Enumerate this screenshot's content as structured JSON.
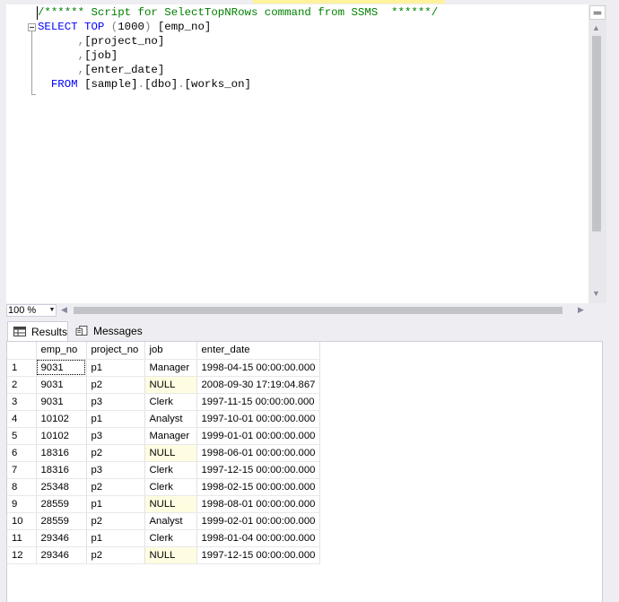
{
  "editor": {
    "lines": [
      [
        {
          "t": "/****** Script for SelectTopNRows command from SSMS  ******/",
          "c": "cm"
        }
      ],
      [
        {
          "t": "SELECT TOP ",
          "c": "kw"
        },
        {
          "t": "(",
          "c": "gr"
        },
        {
          "t": "1000",
          "c": "tx"
        },
        {
          "t": ")",
          "c": "gr"
        },
        {
          "t": " [emp_no]",
          "c": "tx"
        }
      ],
      [
        {
          "t": "      ",
          "c": "tx"
        },
        {
          "t": ",",
          "c": "gr"
        },
        {
          "t": "[project_no]",
          "c": "tx"
        }
      ],
      [
        {
          "t": "      ",
          "c": "tx"
        },
        {
          "t": ",",
          "c": "gr"
        },
        {
          "t": "[job]",
          "c": "tx"
        }
      ],
      [
        {
          "t": "      ",
          "c": "tx"
        },
        {
          "t": ",",
          "c": "gr"
        },
        {
          "t": "[enter_date]",
          "c": "tx"
        }
      ],
      [
        {
          "t": "  FROM ",
          "c": "kw"
        },
        {
          "t": "[sample]",
          "c": "tx"
        },
        {
          "t": ".",
          "c": "gr"
        },
        {
          "t": "[dbo]",
          "c": "tx"
        },
        {
          "t": ".",
          "c": "gr"
        },
        {
          "t": "[works_on]",
          "c": "tx"
        }
      ]
    ]
  },
  "zoom": {
    "value": "100 %"
  },
  "tabs": {
    "results": "Results",
    "messages": "Messages"
  },
  "grid": {
    "columns": [
      "emp_no",
      "project_no",
      "job",
      "enter_date"
    ],
    "rows": [
      [
        "1",
        "9031",
        "p1",
        "Manager",
        "1998-04-15 00:00:00.000"
      ],
      [
        "2",
        "9031",
        "p2",
        "NULL",
        "2008-09-30 17:19:04.867"
      ],
      [
        "3",
        "9031",
        "p3",
        "Clerk",
        "1997-11-15 00:00:00.000"
      ],
      [
        "4",
        "10102",
        "p1",
        "Analyst",
        "1997-10-01 00:00:00.000"
      ],
      [
        "5",
        "10102",
        "p3",
        "Manager",
        "1999-01-01 00:00:00.000"
      ],
      [
        "6",
        "18316",
        "p2",
        "NULL",
        "1998-06-01 00:00:00.000"
      ],
      [
        "7",
        "18316",
        "p3",
        "Clerk",
        "1997-12-15 00:00:00.000"
      ],
      [
        "8",
        "25348",
        "p2",
        "Clerk",
        "1998-02-15 00:00:00.000"
      ],
      [
        "9",
        "28559",
        "p1",
        "NULL",
        "1998-08-01 00:00:00.000"
      ],
      [
        "10",
        "28559",
        "p2",
        "Analyst",
        "1999-02-01 00:00:00.000"
      ],
      [
        "11",
        "29346",
        "p1",
        "Clerk",
        "1998-01-04 00:00:00.000"
      ],
      [
        "12",
        "29346",
        "p2",
        "NULL",
        "1997-12-15 00:00:00.000"
      ]
    ]
  },
  "colors": {
    "keyword": "#0000ff",
    "comment": "#008000",
    "null_cell": "#fffde1"
  }
}
